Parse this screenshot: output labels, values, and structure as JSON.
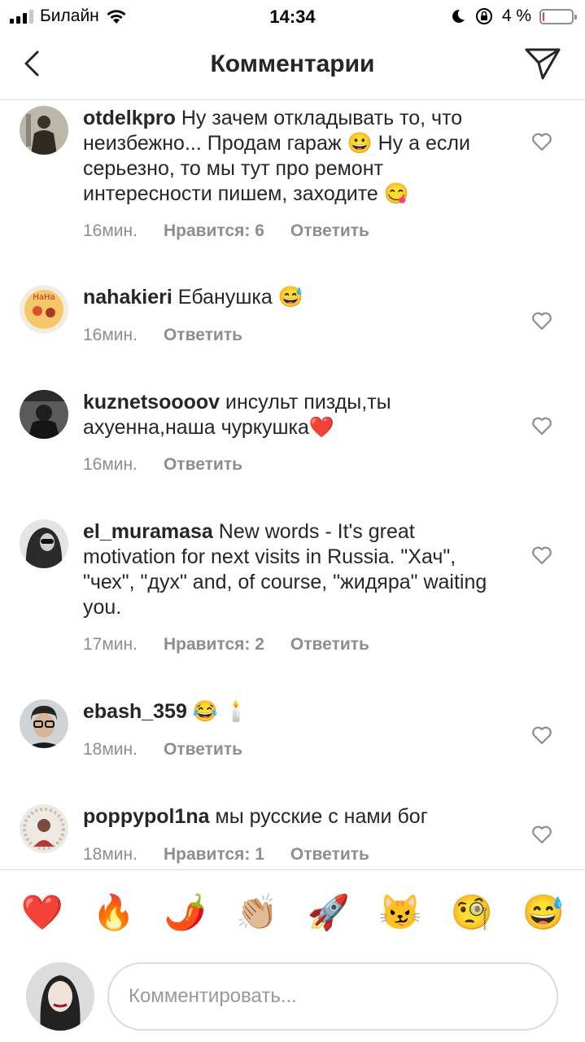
{
  "status_bar": {
    "carrier": "Билайн",
    "time": "14:34",
    "battery_percent": "4 %",
    "battery_level": 0.04,
    "icons": [
      "signal-icon",
      "wifi-icon",
      "moon-icon",
      "orientation-lock-icon",
      "battery-icon"
    ]
  },
  "header": {
    "title": "Комментарии",
    "back_icon": "chevron-left-icon",
    "send_icon": "paper-plane-icon"
  },
  "comments": [
    {
      "username": "otdelkpro",
      "text": "Ну зачем откладывать то, что неизбежно... Продам гараж 😀 Ну а если серьезно, то мы тут про ремонт интересности пишем, заходите 😋",
      "time": "16мин.",
      "likes": "Нравится: 6",
      "reply": "Ответить"
    },
    {
      "username": "nahakieri",
      "text": "Ебанушка 😅",
      "time": "16мин.",
      "reply": "Ответить"
    },
    {
      "username": "kuznetsoooov",
      "text": "инсульт пизды,ты ахуенна,наша чуркушка❤️",
      "time": "16мин.",
      "reply": "Ответить"
    },
    {
      "username": "el_muramasa",
      "text": "New words - It's great motivation for next visits in Russia. \"Хач\", \"чех\", \"дух\" and, of course, \"жидяра\" waiting you.",
      "time": "17мин.",
      "likes": "Нравится: 2",
      "reply": "Ответить"
    },
    {
      "username": "ebash_359",
      "text": "😂 🕯️",
      "time": "18мин.",
      "reply": "Ответить"
    },
    {
      "username": "poppypol1na",
      "text": "мы русские с нами бог",
      "time": "18мин.",
      "likes": "Нравится: 1",
      "reply": "Ответить"
    }
  ],
  "emoji_bar": [
    "❤️",
    "🔥",
    "🌶️",
    "👏🏼",
    "🚀",
    "😼",
    "🧐",
    "😅"
  ],
  "composer": {
    "placeholder": "Комментировать..."
  },
  "colors": {
    "text": "#262626",
    "secondary": "#8e8e8e",
    "divider": "#dbdbdb",
    "battery_low": "#ff3b30"
  }
}
